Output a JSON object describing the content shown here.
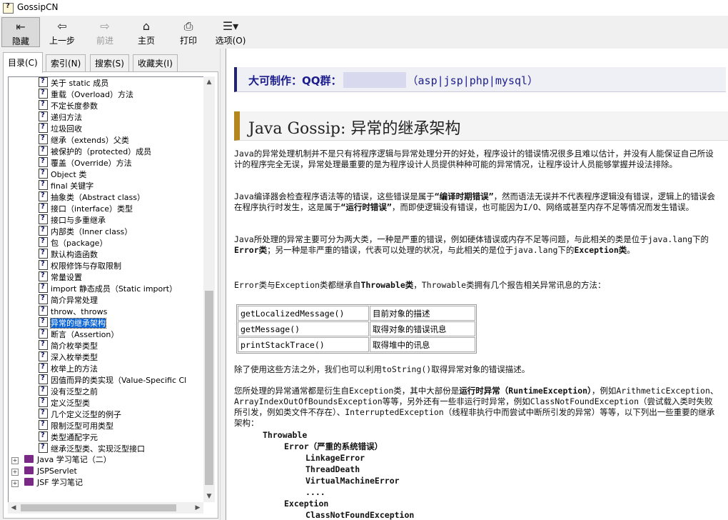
{
  "window": {
    "title": "GossipCN"
  },
  "toolbar": {
    "hide": "隐藏",
    "back": "上一步",
    "forward": "前进",
    "home": "主页",
    "print": "打印",
    "options": "选项(O)"
  },
  "tabs": [
    "目录(C)",
    "索引(N)",
    "搜索(S)",
    "收藏夹(I)"
  ],
  "tree": {
    "items": [
      "关于 static 成员",
      "重载（Overload）方法",
      "不定长度参数",
      "递归方法",
      "垃圾回收",
      "继承（extends）父类",
      "被保护的（protected）成员",
      "覆盖（Override）方法",
      "Object 类",
      "final 关键字",
      "抽象类（Abstract class）",
      "接口（interface）类型",
      "接口与多重继承",
      "内部类（Inner class）",
      "包（package）",
      "默认构造函数",
      "权限修饰与存取限制",
      "常量设置",
      "import 静态成员（Static import）",
      "简介异常处理",
      "throw、throws",
      "异常的继承架构",
      "断言（Assertion）",
      "简介枚举类型",
      "深入枚举类型",
      "枚举上的方法",
      "因值而异的类实现（Value-Specific Cl",
      "没有泛型之前",
      "定义泛型类",
      "几个定义泛型的例子",
      "限制泛型可用类型",
      "类型通配字元",
      "继承泛型类、实现泛型接口"
    ],
    "selected_index": 21,
    "books": [
      "Java 学习笔记（二）",
      "JSPServlet",
      "JSF 学习笔记"
    ]
  },
  "content": {
    "banner_prefix": "大可制作：QQ群：",
    "banner_suffix": "（asp|jsp|php|mysql）",
    "heading": "Java Gossip: 异常的继承架构",
    "p1": "Java的异常处理机制并不是只有将程序逻辑与异常处理分开的好处，程序设计的错误情况很多且难以估计，并没有人能保证自己所设计的程序完全无误，异常处理最重要的是为程序设计人员提供种种可能的异常情况，让程序设计人员能够掌握并设法排除。",
    "p2_a": "Java编译器会检查程序语法等的错误，这些错误是属于",
    "p2_b": "“编译时期错误”",
    "p2_c": "，然而语法无误并不代表程序逻辑没有错误，逻辑上的错误会在程序执行时发生，这是属于",
    "p2_d": "“运行时错误”",
    "p2_e": "，而即使逻辑没有错误，也可能因为I/O、网络或甚至内存不足等情况而发生错误。",
    "p3_a": "Java所处理的异常主要可分为两大类，一种是严重的错误，例如硬体错误或内存不足等问题，与此相关的类是位于java.lang下的",
    "p3_b": "Error类",
    "p3_c": "；另一种是非严重的错误，代表可以处理的状况，与此相关的是位于java.lang下的",
    "p3_d": "Exception类",
    "p3_e": "。",
    "p4_a": "Error类与Exception类都继承自",
    "p4_b": "Throwable类",
    "p4_c": "，Throwable类拥有几个报告相关异常讯息的方法：",
    "methods": [
      [
        "getLocalizedMessage()",
        "目前对象的描述"
      ],
      [
        "getMessage()",
        "取得对象的错误讯息"
      ],
      [
        "printStackTrace()",
        "取得堆中的讯息"
      ]
    ],
    "p5": "除了使用这些方法之外，我们也可以利用toString()取得异常对象的错误描述。",
    "p6_a": "您所处理的异常通常都是衍生自Exception类，其中大部份是",
    "p6_b": "运行时异常（RuntimeException）",
    "p6_c": "，例如ArithmeticException、ArrayIndexOutOfBoundsException等等，另外还有一些非运行时异常，例如ClassNotFoundException（尝试载入类时失败所引发，例如类文件不存在）、InterruptedException（线程非执行中而尝试中断所引发的异常）等等，以下列出一些重要的继承架构：",
    "hierarchy": [
      "Throwable",
      "Error（严重的系统错误）",
      "LinkageError",
      "ThreadDeath",
      "VirtualMachineError",
      "....",
      "Exception",
      "ClassNotFoundException"
    ]
  }
}
